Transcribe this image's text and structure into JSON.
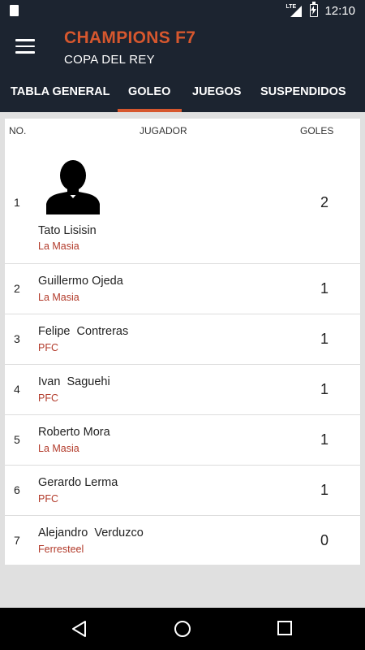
{
  "status_bar": {
    "time": "12:10",
    "network": "LTE"
  },
  "app_bar": {
    "title": "CHAMPIONS F7",
    "subtitle": "COPA DEL REY"
  },
  "tabs": [
    {
      "label": "TABLA GENERAL",
      "active": false
    },
    {
      "label": "GOLEO",
      "active": true
    },
    {
      "label": "JUEGOS",
      "active": false
    },
    {
      "label": "SUSPENDIDOS",
      "active": false
    }
  ],
  "table": {
    "headers": {
      "no": "NO.",
      "player": "JUGADOR",
      "goals": "GOLES"
    },
    "rows": [
      {
        "no": "1",
        "name": "Tato Lisisin",
        "team": "La Masia",
        "goals": "2"
      },
      {
        "no": "2",
        "name": "Guillermo Ojeda",
        "team": "La Masia",
        "goals": "1"
      },
      {
        "no": "3",
        "name": "Felipe  Contreras",
        "team": "PFC",
        "goals": "1"
      },
      {
        "no": "4",
        "name": "Ivan  Saguehi",
        "team": "PFC",
        "goals": "1"
      },
      {
        "no": "5",
        "name": "Roberto Mora",
        "team": "La Masia",
        "goals": "1"
      },
      {
        "no": "6",
        "name": "Gerardo Lerma",
        "team": "PFC",
        "goals": "1"
      },
      {
        "no": "7",
        "name": "Alejandro  Verduzco",
        "team": "Ferresteel",
        "goals": "0"
      }
    ]
  },
  "colors": {
    "accent": "#d6572e",
    "header_bg": "#1c2430",
    "team_text": "#b23a2a"
  }
}
